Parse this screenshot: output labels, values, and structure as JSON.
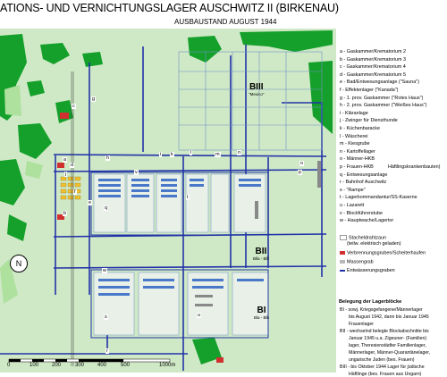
{
  "header": {
    "title": "ATIONS- UND VERNICHTUNGSLAGER AUSCHWITZ II (BIRKENAU)",
    "subtitle": "AUSBAUSTAND AUGUST 1944"
  },
  "colors": {
    "forest": "#14a02a",
    "meadow": "#c8e8c0",
    "road": "#2233a8",
    "building_red": "#d03030",
    "building_yellow": "#f0c030",
    "grid": "#7090c8"
  },
  "sectors": {
    "b1": {
      "code": "BI",
      "name": "Bla - Blb"
    },
    "b2": {
      "code": "BII",
      "name": "Blla - Bllf"
    },
    "b3": {
      "code": "BIII",
      "name": "\"Mexico\""
    }
  },
  "map_letters": [
    "a",
    "b",
    "c",
    "d",
    "e",
    "f",
    "g",
    "h",
    "i",
    "j",
    "k",
    "l",
    "m",
    "n",
    "o",
    "p",
    "q",
    "r",
    "s",
    "t",
    "u",
    "v",
    "w"
  ],
  "compass": "N",
  "scale": {
    "labels": [
      "0",
      "100",
      "200",
      "300",
      "400",
      "500"
    ],
    "end_label": "1000m"
  },
  "legend": {
    "items": [
      "a - Gaskammer/Krematorium 2",
      "b - Gaskammer/Krematorium 3",
      "c - Gaskammer/Krematorium 4",
      "d - Gaskammer/Krematorium 5",
      "e - Bad/Entwesungsanlage (\"Sauna\")",
      "f - Effektenlager (\"Kanada\")",
      "g - 1. prov. Gaskammer (\"Rotes Haus\")",
      "h - 2. prov. Gaskammer (\"Weißes Haus\")",
      "i - Kläranlage",
      "j - Zwinger für Diensthunde",
      "k - Küchenbaracke",
      "l - Wäscherei",
      "m - Kiesgrube",
      "n - Kartoffellager",
      "o - Männer-HKB",
      "p - Frauen-HKB",
      "q - Entwesungsanlage",
      "r - Bahnhof Auschwitz",
      "s - \"Rampe\"",
      "t - Lagerkommandantur/SS-Kaserne",
      "u - Lazarett",
      "v - Blockführerstube",
      "w - Hauptwache/Lagertor"
    ],
    "hkb_note": "Häftlingskrankenbauten)",
    "symbols": [
      "Stacheldrahtzaun",
      "(teilw. elektrisch geladen)",
      "Verbrennungsgruben/Scheiterhaufen",
      "Massengrab",
      "Entwässerungsgraben"
    ],
    "key_title": "Belegung der Lagerblöcke",
    "key_lines": [
      "BI - sowj. Kriegsgefangene/Männerlager",
      "bis August 1942, dann bis Januar 1945",
      "Frauenlager",
      "BII - wechselnd belegte Blockabschnitte bis",
      "Januar 1945 u.a. Zigeuner- (Familien)",
      "lager, Theresienstädter Familienlager,",
      "Männerlager, Männer-Quarantänelager,",
      "ungarische Juden (bes. Frauen)",
      "BIII - bis Oktober 1944 Lager für jüdische",
      "Häftlinge (bes. Frauen aus Ungarn)"
    ]
  }
}
